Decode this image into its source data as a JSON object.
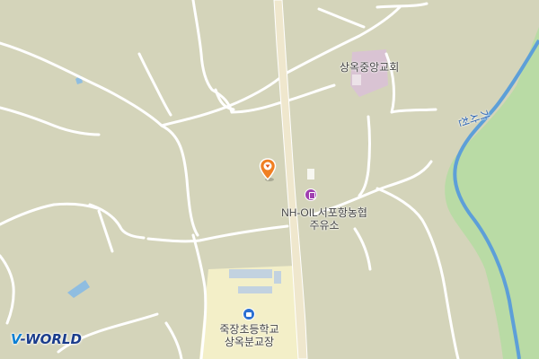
{
  "map": {
    "palette": {
      "land": "#d4d4ba",
      "road": "#ffffff",
      "highway": "#efe7cd",
      "stream": "#5d9fd8",
      "riverbank": "#b9dba5",
      "school_area": "#f3efc8",
      "church_area": "#d9c3d3",
      "building": "#c2d2e0"
    },
    "labels": {
      "church": "상옥중앙교회",
      "gas_station_line1": "NH-OIL서포항농협",
      "gas_station_line2": "주유소",
      "school_line1": "죽장초등학교",
      "school_line2": "상옥분교장",
      "stream": "가사천"
    },
    "icons": {
      "location_marker": "location-pin-icon",
      "gas_station": "gas-station-icon",
      "school": "school-icon"
    },
    "branding": {
      "logo_text_v": "V",
      "logo_text_rest": "-WORLD"
    }
  }
}
